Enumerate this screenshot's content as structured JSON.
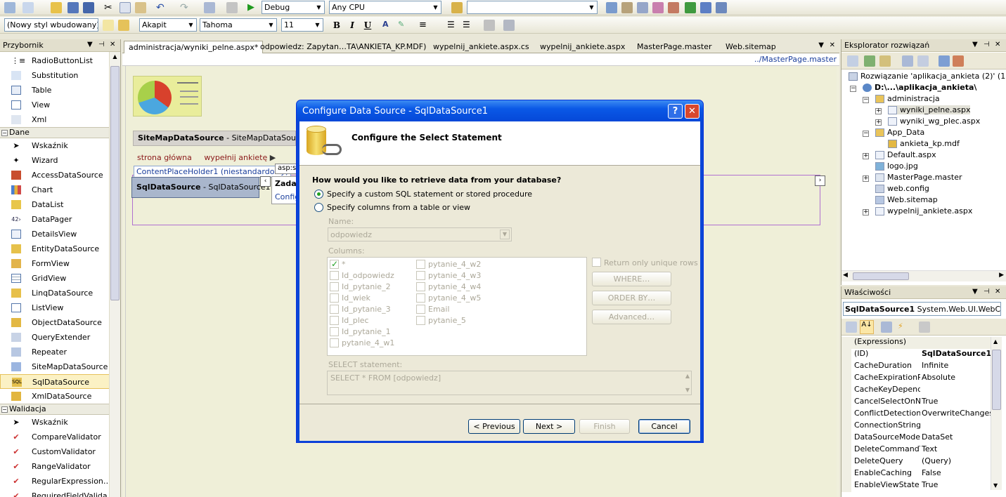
{
  "toolbar1": {
    "config": "Debug",
    "platform": "Any CPU",
    "find": ""
  },
  "toolbar2": {
    "style": "(Nowy styl wbudowany)",
    "block": "Akapit",
    "font": "Tahoma",
    "size": "11",
    "bold": "B",
    "italic": "I",
    "underline": "U"
  },
  "toolbox": {
    "title": "Przybornik",
    "items_top": [
      "RadioButtonList",
      "Substitution",
      "Table",
      "View",
      "Xml"
    ],
    "group_data": "Dane",
    "items_data": [
      "Wskaźnik",
      "Wizard",
      "AccessDataSource",
      "Chart",
      "DataList",
      "DataPager",
      "DetailsView",
      "EntityDataSource",
      "FormView",
      "GridView",
      "LinqDataSource",
      "ListView",
      "ObjectDataSource",
      "QueryExtender",
      "Repeater",
      "SiteMapDataSource",
      "SqlDataSource",
      "XmlDataSource"
    ],
    "group_validation": "Walidacja",
    "items_validation": [
      "Wskaźnik",
      "CompareValidator",
      "CustomValidator",
      "RangeValidator",
      "RegularExpression…",
      "RequiredFieldValida…"
    ]
  },
  "tabs": [
    "administracja/wyniki_pelne.aspx*",
    "odpowiedz: Zapytan…TA\\ANKIETA_KP.MDF)",
    "wypelnij_ankiete.aspx.cs",
    "wypelnij_ankiete.aspx",
    "MasterPage.master",
    "Web.sitemap"
  ],
  "designer": {
    "masterpage_link": "../MasterPage.master",
    "sitemap_label": "SiteMapDataSource",
    "sitemap_id": " - SiteMapDataSource1",
    "breadcrumb_home": "strona główna",
    "breadcrumb_page": "wypełnij ankietę",
    "content_placeholder": "ContentPlaceHolder1 (niestandardowy)",
    "asp_tag": "asp:s",
    "sqlds_label": "SqlDataSource",
    "sqlds_id": " - SqlDataSource1",
    "tasks_title": "Zadan",
    "tasks_link": "Config"
  },
  "dialog": {
    "title": "Configure Data Source - SqlDataSource1",
    "heading": "Configure the Select Statement",
    "question": "How would you like to retrieve data from your database?",
    "option_custom": "Specify a custom SQL statement or stored procedure",
    "option_columns": "Specify columns from a table or view",
    "name_label": "Name:",
    "name_value": "odpowiedz",
    "columns_label": "Columns:",
    "columns_left": [
      "*",
      "Id_odpowiedz",
      "Id_pytanie_2",
      "Id_wiek",
      "Id_pytanie_3",
      "Id_plec",
      "Id_pytanie_1",
      "pytanie_4_w1"
    ],
    "columns_right": [
      "pytanie_4_w2",
      "pytanie_4_w3",
      "pytanie_4_w4",
      "pytanie_4_w5",
      "Email",
      "pytanie_5"
    ],
    "unique_rows": "Return only unique rows",
    "where_btn": "WHERE…",
    "orderby_btn": "ORDER BY…",
    "advanced_btn": "Advanced…",
    "select_label": "SELECT statement:",
    "select_value": "SELECT * FROM [odpowiedz]",
    "prev_btn": "< Previous",
    "next_btn": "Next >",
    "finish_btn": "Finish",
    "cancel_btn": "Cancel"
  },
  "solution": {
    "title": "Eksplorator rozwiązań",
    "root": "Rozwiązanie 'aplikacja_ankieta (2)' (1 pro",
    "project": "D:\\...\\aplikacja_ankieta\\",
    "items": [
      {
        "label": "administracja",
        "indent": 1,
        "icon": "folder-icon"
      },
      {
        "label": "wyniki_pelne.aspx",
        "indent": 2,
        "icon": "aspx-file-icon"
      },
      {
        "label": "wyniki_wg_plec.aspx",
        "indent": 2,
        "icon": "aspx-file-icon"
      },
      {
        "label": "App_Data",
        "indent": 1,
        "icon": "folder-icon"
      },
      {
        "label": "ankieta_kp.mdf",
        "indent": 2,
        "icon": "database-icon"
      },
      {
        "label": "Default.aspx",
        "indent": 1,
        "icon": "aspx-file-icon"
      },
      {
        "label": "logo.jpg",
        "indent": 1,
        "icon": "image-file-icon"
      },
      {
        "label": "MasterPage.master",
        "indent": 1,
        "icon": "master-file-icon"
      },
      {
        "label": "web.config",
        "indent": 1,
        "icon": "config-file-icon"
      },
      {
        "label": "Web.sitemap",
        "indent": 1,
        "icon": "sitemap-file-icon"
      },
      {
        "label": "wypelnij_ankiete.aspx",
        "indent": 1,
        "icon": "aspx-file-icon"
      }
    ]
  },
  "properties": {
    "title": "Właściwości",
    "object": "SqlDataSource1",
    "object_type": "System.Web.UI.WebCo",
    "rows": [
      {
        "name": "(Expressions)",
        "value": ""
      },
      {
        "name": "(ID)",
        "value": "SqlDataSource1"
      },
      {
        "name": "CacheDuration",
        "value": "Infinite"
      },
      {
        "name": "CacheExpirationPol",
        "value": "Absolute"
      },
      {
        "name": "CacheKeyDepende",
        "value": ""
      },
      {
        "name": "CancelSelectOnNull",
        "value": "True"
      },
      {
        "name": "ConflictDetection",
        "value": "OverwriteChanges"
      },
      {
        "name": "ConnectionString",
        "value": ""
      },
      {
        "name": "DataSourceMode",
        "value": "DataSet"
      },
      {
        "name": "DeleteCommandTyp",
        "value": "Text"
      },
      {
        "name": "DeleteQuery",
        "value": "(Query)"
      },
      {
        "name": "EnableCaching",
        "value": "False"
      },
      {
        "name": "EnableViewState",
        "value": "True"
      }
    ]
  }
}
